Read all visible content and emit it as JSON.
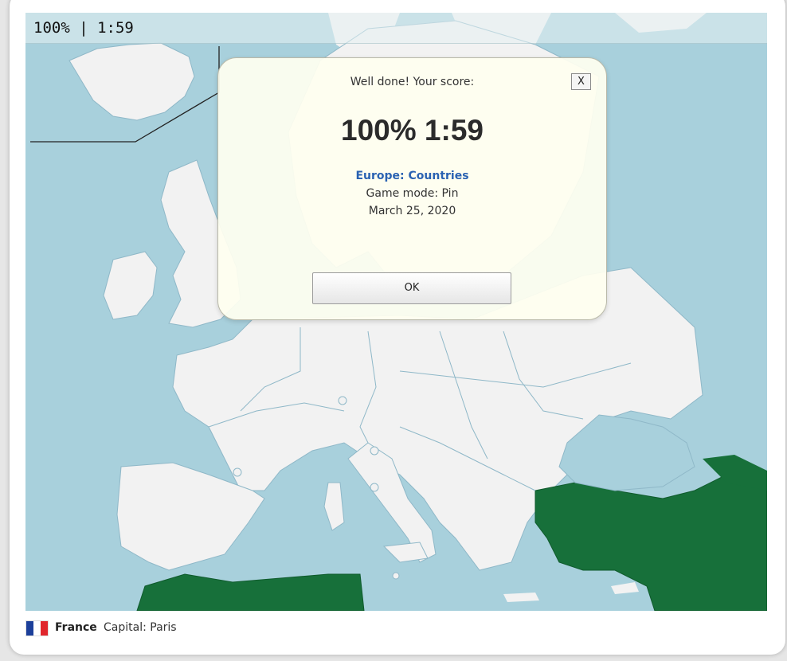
{
  "status": {
    "text": "100% | 1:59"
  },
  "modal": {
    "heading": "Well done! Your score:",
    "close_label": "X",
    "score": "100% 1:59",
    "quiz_title": "Europe: Countries",
    "game_mode": "Game mode: Pin",
    "date": "March 25, 2020",
    "ok_label": "OK"
  },
  "footer": {
    "country": "France",
    "capital": "Capital: Paris",
    "flag_colors": [
      "#1c3f9a",
      "#ffffff",
      "#e0262c"
    ]
  },
  "colors": {
    "sea": "#a8d0dc",
    "land": "#f2f2f2",
    "highlighted_land": "#17703a",
    "border": "#8fb8c8"
  }
}
